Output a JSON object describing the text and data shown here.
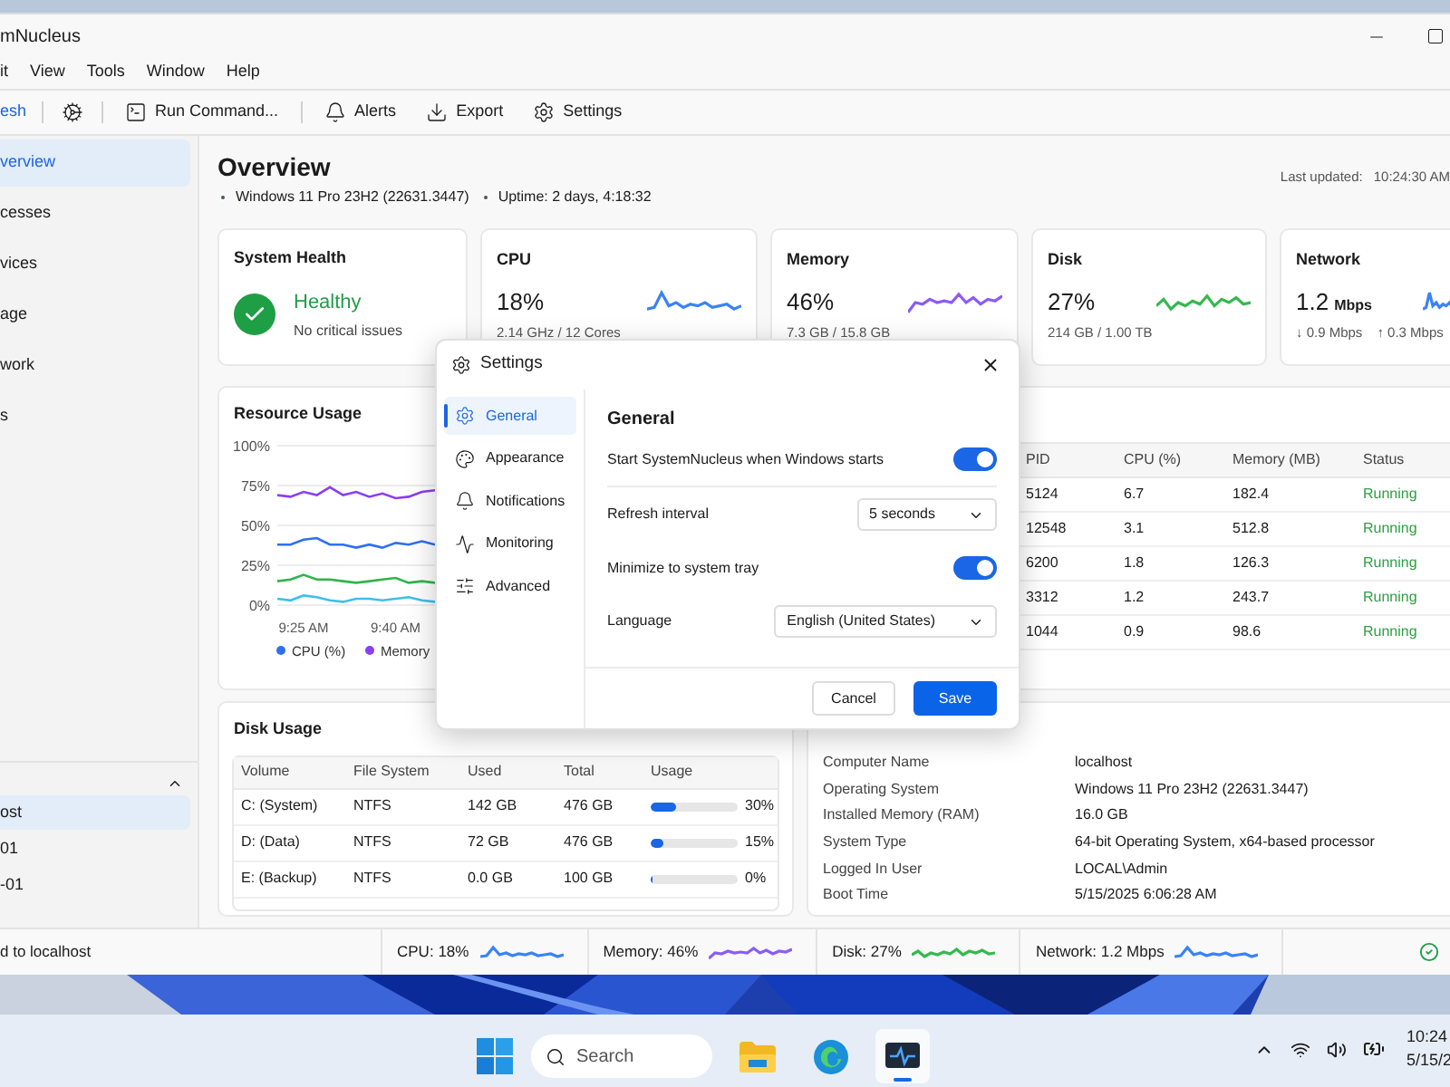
{
  "window": {
    "title": "mNucleus"
  },
  "menu": [
    "it",
    "View",
    "Tools",
    "Window",
    "Help"
  ],
  "toolbar": [
    {
      "kind": "primary",
      "label": "esh"
    },
    {
      "kind": "separator"
    },
    {
      "kind": "icon"
    },
    {
      "kind": "separator"
    },
    {
      "kind": "button",
      "label": "Run Command..."
    },
    {
      "kind": "separator"
    },
    {
      "kind": "button",
      "label": "Alerts"
    },
    {
      "kind": "button",
      "label": "Export"
    },
    {
      "kind": "button",
      "label": "Settings"
    }
  ],
  "sidebar": {
    "items": [
      {
        "label": "verview",
        "selected": true
      },
      {
        "label": "cesses",
        "selected": false
      },
      {
        "label": "vices",
        "selected": false
      },
      {
        "label": "age",
        "selected": false
      },
      {
        "label": "work",
        "selected": false
      },
      {
        "label": "s",
        "selected": false
      }
    ],
    "group": {
      "expanded": true,
      "items": [
        {
          "label": "ost",
          "selected": true
        },
        {
          "label": "01",
          "selected": false
        },
        {
          "label": "-01",
          "selected": false
        }
      ]
    }
  },
  "overview": {
    "title": "Overview",
    "info": [
      "Windows 11 Pro 23H2 (22631.3447)",
      "Uptime: 2 days, 4:18:32"
    ],
    "last_updated_label": "Last updated:",
    "last_updated": "10:24:30 AM"
  },
  "health": {
    "title": "System Health",
    "status": "Healthy",
    "note": "No critical issues"
  },
  "metrics": [
    {
      "title": "CPU",
      "value": "18%",
      "detail": "2.14 GHz / 12 Cores",
      "color": "#3b82f6"
    },
    {
      "title": "Memory",
      "value": "46%",
      "detail": "7.3 GB / 15.8 GB",
      "color": "#8b5cf6"
    },
    {
      "title": "Disk",
      "value": "27%",
      "detail": "214 GB / 1.00 TB",
      "color": "#34b94e"
    },
    {
      "title": "Network",
      "value": "1.2",
      "unit": "Mbps",
      "detail": "↓ 0.9 Mbps",
      "detail_2": "↑ 0.3 Mbps",
      "color": "#3b82f6"
    }
  ],
  "resource_usage": {
    "title": "Resource Usage",
    "chart_data": {
      "type": "line",
      "grid": true,
      "legend": "bottom",
      "categories": [
        null,
        null,
        "9:25 AM",
        null,
        null,
        null,
        null,
        null,
        null,
        "9:40 AM",
        null,
        null,
        null
      ],
      "ylim": [
        0,
        100
      ],
      "yticks": [
        {
          "value": 100,
          "label": "100%"
        },
        {
          "value": 75,
          "label": "75%"
        },
        {
          "value": 50,
          "label": "50%"
        },
        {
          "value": 25,
          "label": "25%"
        },
        {
          "value": 0,
          "label": "0%"
        }
      ],
      "series": [
        {
          "name": "CPU (%)",
          "color": "#2f6ff0",
          "values": [
            38,
            38,
            41,
            42,
            38,
            38,
            36,
            38,
            36,
            39,
            38,
            40,
            38
          ]
        },
        {
          "name": "Memory",
          "color": "#8a3ff0",
          "values": [
            69,
            68,
            71,
            69,
            74,
            69,
            71,
            68,
            70,
            67,
            68,
            71,
            72
          ]
        },
        {
          "color": "#2fb54a",
          "values": [
            15,
            16,
            19,
            16,
            16,
            15,
            14,
            15,
            16,
            17,
            14,
            15,
            14
          ]
        },
        {
          "color": "#3cc0ea",
          "values": [
            4,
            3,
            6,
            5,
            3,
            2,
            4,
            4,
            3,
            4,
            5,
            3,
            2
          ]
        }
      ]
    }
  },
  "processes": {
    "columns": [
      "PID",
      "CPU (%)",
      "Memory (MB)",
      "Status"
    ],
    "rows": [
      {
        "pid": "5124",
        "cpu": "6.7",
        "memory": "182.4",
        "status": "Running"
      },
      {
        "pid": "12548",
        "cpu": "3.1",
        "memory": "512.8",
        "status": "Running"
      },
      {
        "pid": "6200",
        "cpu": "1.8",
        "memory": "126.3",
        "status": "Running"
      },
      {
        "pid": "3312",
        "cpu": "1.2",
        "memory": "243.7",
        "status": "Running"
      },
      {
        "pid": "1044",
        "cpu": "0.9",
        "memory": "98.6",
        "status": "Running"
      }
    ]
  },
  "disk_usage": {
    "title": "Disk Usage",
    "columns": [
      "Volume",
      "File System",
      "Used",
      "Total",
      "Usage"
    ],
    "rows": [
      {
        "volume": "C: (System)",
        "fs": "NTFS",
        "used": "142 GB",
        "total": "476 GB",
        "level": 0.3,
        "percent": "30%"
      },
      {
        "volume": "D: (Data)",
        "fs": "NTFS",
        "used": "72 GB",
        "total": "476 GB",
        "level": 0.15,
        "percent": "15%"
      },
      {
        "volume": "E: (Backup)",
        "fs": "NTFS",
        "used": "0.0 GB",
        "total": "100 GB",
        "level": 0,
        "percent": "0%"
      }
    ]
  },
  "system_info": [
    {
      "label": "Computer Name",
      "value": "localhost"
    },
    {
      "label": "Operating System",
      "value": "Windows 11 Pro 23H2 (22631.3447)"
    },
    {
      "label": "Installed Memory (RAM)",
      "value": "16.0 GB"
    },
    {
      "label": "System Type",
      "value": "64-bit Operating System, x64-based processor"
    },
    {
      "label": "Logged In User",
      "value": "LOCAL\\Admin"
    },
    {
      "label": "Boot Time",
      "value": "5/15/2025 6:06:28 AM"
    }
  ],
  "status_bar": {
    "connection": "d to localhost",
    "items": [
      {
        "label": "CPU:",
        "value": "18%",
        "color": "#3b82f6"
      },
      {
        "label": "Memory:",
        "value": "46%",
        "color": "#8b5cf6"
      },
      {
        "label": "Disk:",
        "value": "27%",
        "color": "#34b94e"
      },
      {
        "label": "Network:",
        "value": "1.2 Mbps",
        "color": "#3b82f6"
      }
    ]
  },
  "settings_dialog": {
    "title": "Settings",
    "nav": [
      {
        "label": "General",
        "selected": true
      },
      {
        "label": "Appearance",
        "selected": false
      },
      {
        "label": "Notifications",
        "selected": false
      },
      {
        "label": "Monitoring",
        "selected": false
      },
      {
        "label": "Advanced",
        "selected": false
      }
    ],
    "section_title": "General",
    "options": [
      {
        "kind": "toggle",
        "label": "Start SystemNucleus when Windows starts",
        "on": true
      },
      {
        "kind": "select",
        "label": "Refresh interval",
        "value": "5 seconds"
      },
      {
        "kind": "toggle",
        "label": "Minimize to system tray",
        "on": true
      },
      {
        "kind": "select",
        "label": "Language",
        "value": "English (United States)"
      }
    ],
    "buttons": [
      {
        "kind": "secondary",
        "label": "Cancel"
      },
      {
        "kind": "primary",
        "label": "Save"
      }
    ]
  },
  "taskbar": {
    "search_placeholder": "Search",
    "apps": [
      {
        "selected": false
      },
      {
        "selected": false
      },
      {
        "selected": true
      }
    ],
    "time": "10:24",
    "date": "5/15/2"
  }
}
